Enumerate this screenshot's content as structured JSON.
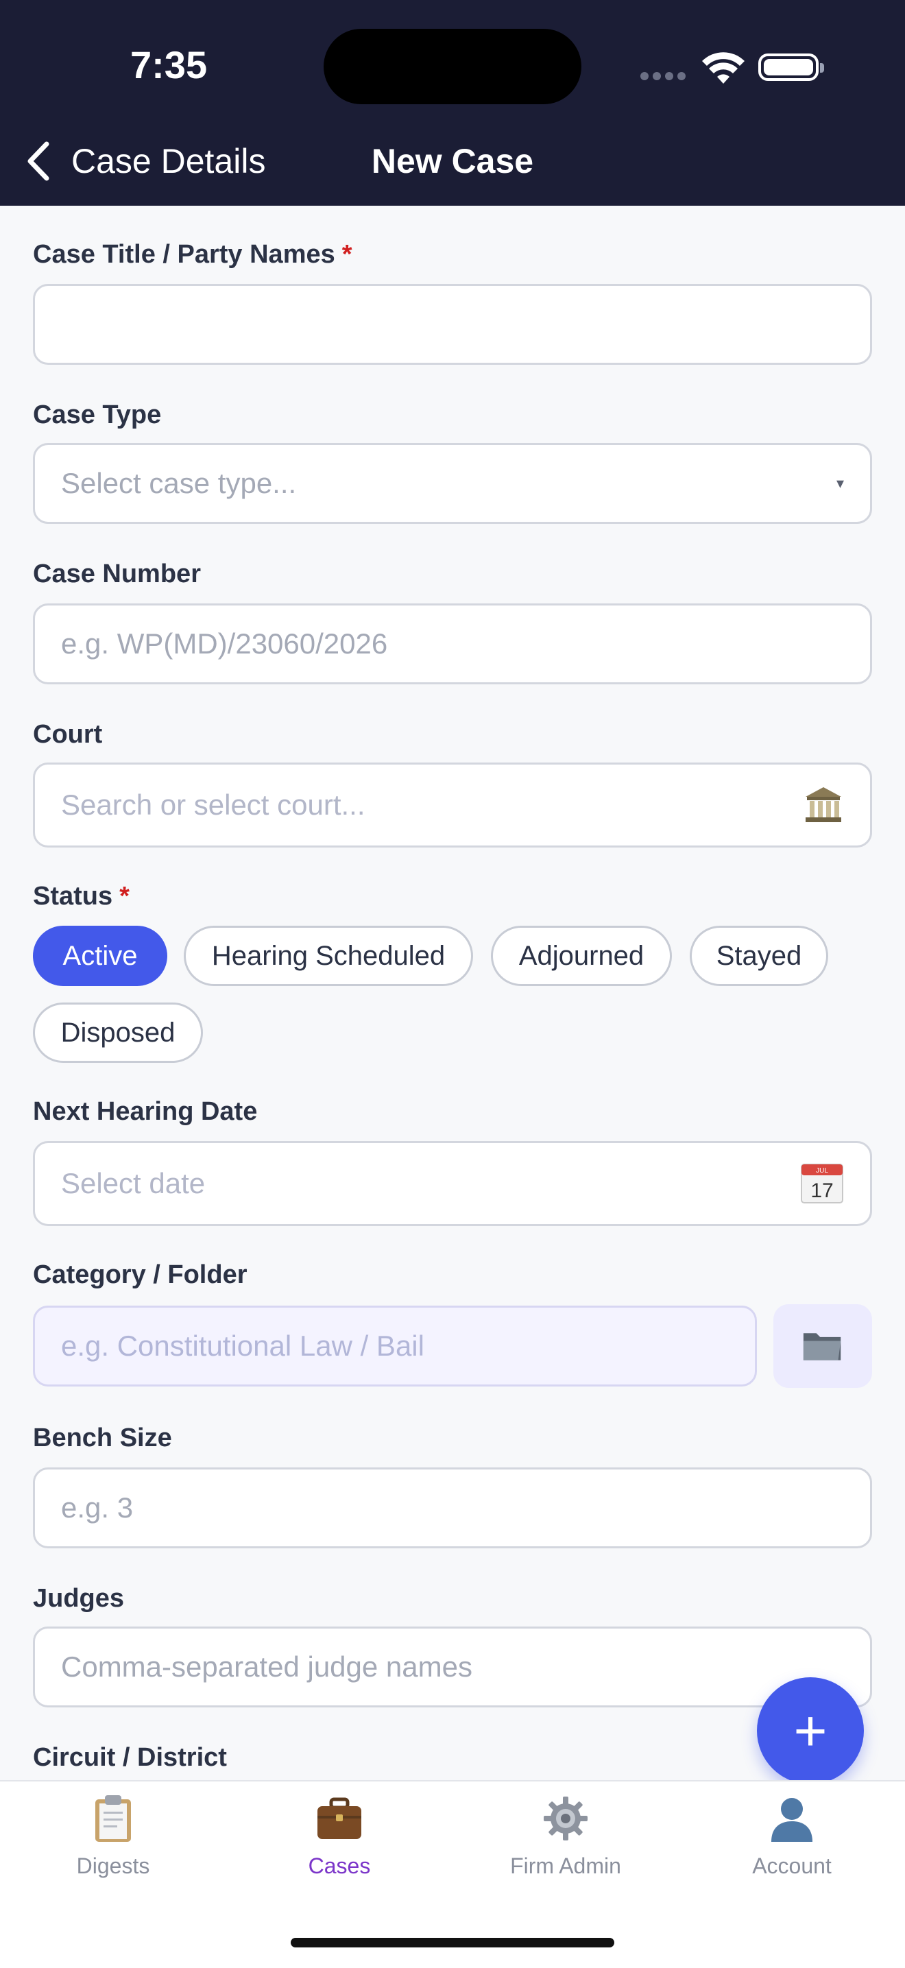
{
  "status_bar": {
    "time": "7:35"
  },
  "nav": {
    "back_label": "Case Details",
    "title": "New Case"
  },
  "form": {
    "case_title": {
      "label": "Case Title / Party Names",
      "required_mark": "*",
      "value": ""
    },
    "case_type": {
      "label": "Case Type",
      "placeholder": "Select case type...",
      "caret": "▾"
    },
    "case_number": {
      "label": "Case Number",
      "placeholder": "e.g. WP(MD)/23060/2026"
    },
    "court": {
      "label": "Court",
      "placeholder": "Search or select court...",
      "icon": "courthouse-icon"
    },
    "status": {
      "label": "Status",
      "required_mark": "*",
      "options": [
        "Active",
        "Hearing Scheduled",
        "Adjourned",
        "Stayed",
        "Disposed"
      ],
      "selected": "Active"
    },
    "next_hearing": {
      "label": "Next Hearing Date",
      "placeholder": "Select date",
      "calendar_month": "JUL",
      "calendar_day": "17"
    },
    "category": {
      "label": "Category / Folder",
      "placeholder": "e.g. Constitutional Law / Bail",
      "icon": "folder-icon"
    },
    "bench_size": {
      "label": "Bench Size",
      "placeholder": "e.g. 3"
    },
    "judges": {
      "label": "Judges",
      "placeholder": "Comma-separated judge names"
    },
    "circuit": {
      "label": "Circuit / District"
    }
  },
  "fab": {
    "symbol": "+"
  },
  "tabs": [
    {
      "label": "Digests",
      "icon": "clipboard-icon"
    },
    {
      "label": "Cases",
      "icon": "briefcase-icon",
      "active": true
    },
    {
      "label": "Firm Admin",
      "icon": "gear-icon"
    },
    {
      "label": "Account",
      "icon": "person-icon"
    }
  ],
  "colors": {
    "header": "#1b1d35",
    "accent": "#4359ea",
    "active_tab": "#7b35c9",
    "required": "#d11f1f"
  }
}
